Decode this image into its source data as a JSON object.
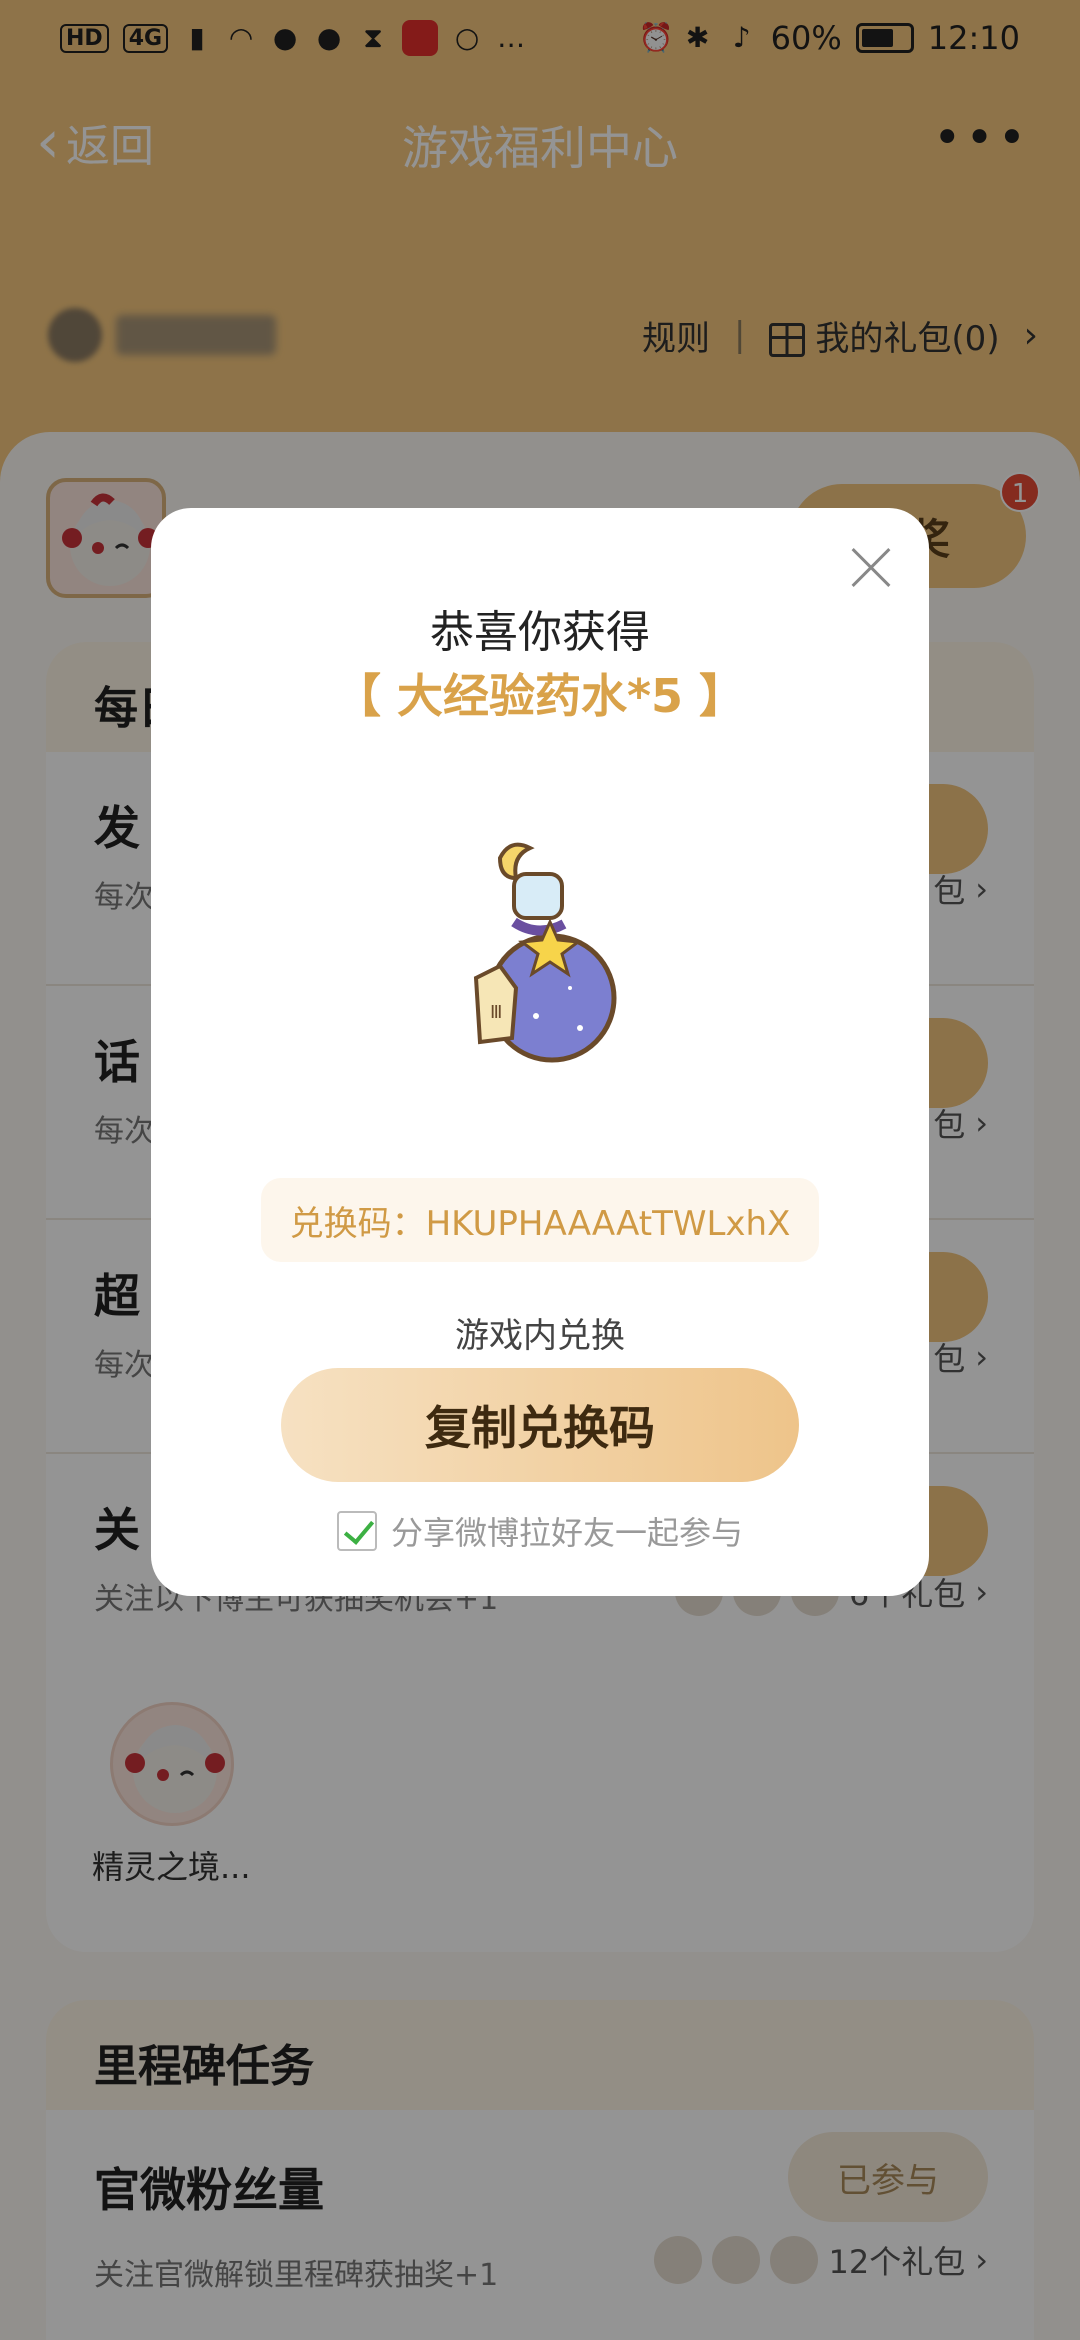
{
  "status_bar": {
    "left_chips": [
      "HD",
      "4G"
    ],
    "battery": "60%",
    "time": "12:10"
  },
  "nav": {
    "back_label": "返回",
    "title": "游戏福利中心",
    "more": "•••"
  },
  "user_row": {
    "rules_label": "规则",
    "my_gifts_label": "我的礼包(0)"
  },
  "lottery": {
    "label": "抽奖",
    "badge": "1"
  },
  "task_card": {
    "heading": "每日",
    "rows": [
      {
        "title": "发",
        "desc": "每次",
        "gifts": "包"
      },
      {
        "title": "话",
        "desc": "每次",
        "gifts": "包"
      },
      {
        "title": "超",
        "desc": "每次",
        "gifts": "包"
      },
      {
        "title": "关",
        "desc": "关注以下博主可获抽奖机会+1",
        "gifts": "6个礼包"
      }
    ],
    "follow_name": "精灵之境..."
  },
  "milestone": {
    "heading": "里程碑任务",
    "task_title": "官微粉丝量",
    "task_desc": "关注官微解锁里程碑获抽奖+1",
    "button": "已参与",
    "gifts": "12个礼包"
  },
  "modal": {
    "title": "恭喜你获得",
    "prize": "【 大经验药水*5 】",
    "code_text": "兑换码：HKUPHAAAAtTWLxhX",
    "redeem_note": "游戏内兑换",
    "copy_button": "复制兑换码",
    "share_label": "分享微博拉好友一起参与",
    "share_checked": true,
    "accent_color": "#d9a24a"
  }
}
